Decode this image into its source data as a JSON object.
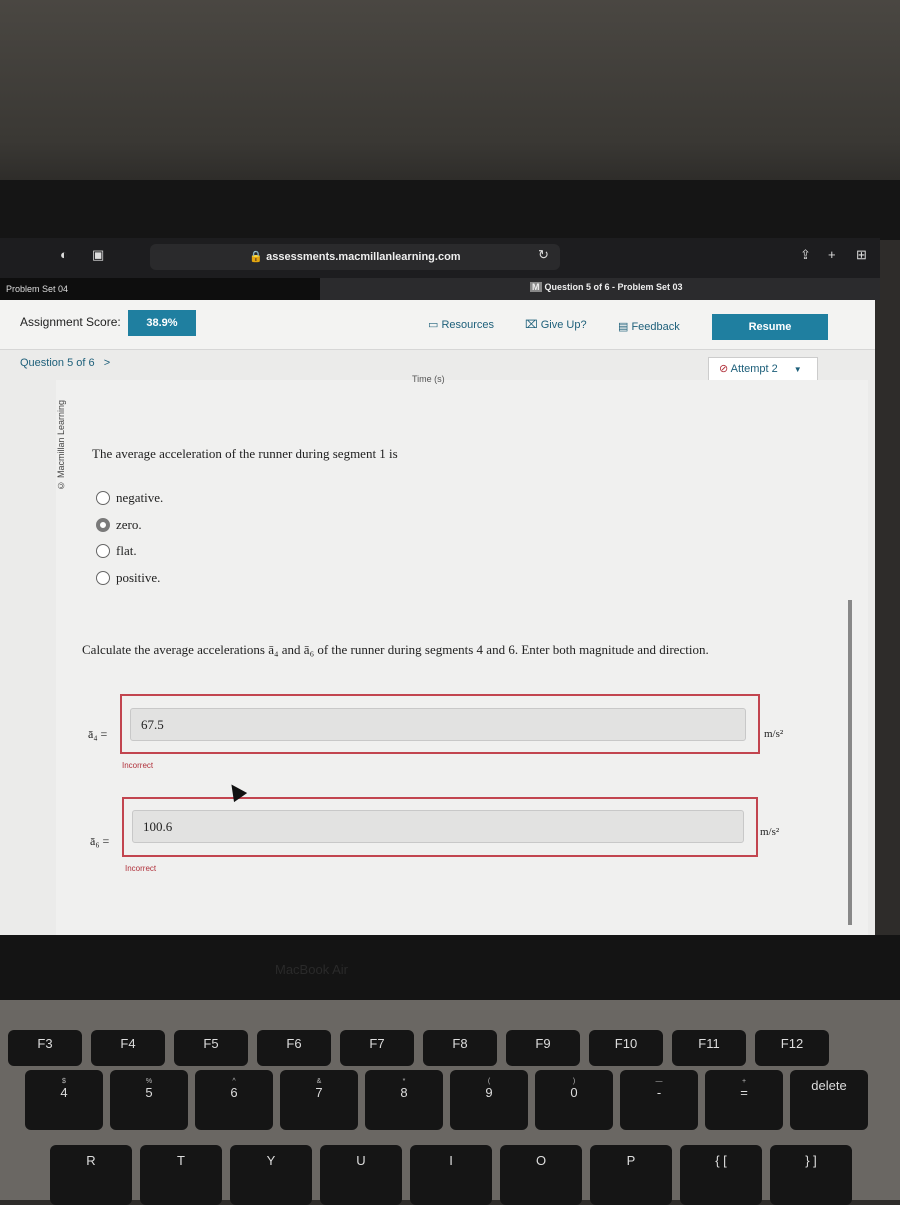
{
  "browser": {
    "url": "assessments.macmillanlearning.com",
    "tab1": "Problem Set 04",
    "tab2": "Question 5 of 6 - Problem Set 03",
    "tab2_badge": "M"
  },
  "header": {
    "score_label": "Assignment Score:",
    "score": "38.9%",
    "resources": "Resources",
    "give_up": "Give Up?",
    "feedback": "Feedback",
    "resume": "Resume"
  },
  "nav": {
    "question": "Question 5 of 6",
    "next": ">",
    "attempt": "Attempt 2"
  },
  "watermark": "© Macmillan Learning",
  "graph_axis_fragment": "Time (s)",
  "q1": {
    "prompt": "The average acceleration of the runner during segment 1 is",
    "options": [
      "negative.",
      "zero.",
      "flat.",
      "positive."
    ],
    "selected": 1
  },
  "q2": {
    "prompt": "Calculate the average accelerations ā₄ and ā₆ of the runner during segments 4 and 6. Enter both magnitude and direction.",
    "fields": [
      {
        "label": "ā₄ =",
        "value": "67.5",
        "unit": "m/s²",
        "status": "Incorrect"
      },
      {
        "label": "ā₆ =",
        "value": "100.6",
        "unit": "m/s²",
        "status": "Incorrect"
      }
    ]
  },
  "device": {
    "brand": "MacBook Air"
  },
  "keyboard": {
    "fn": [
      "F3",
      "F4",
      "F5",
      "F6",
      "F7",
      "F8",
      "F9",
      "F10",
      "F11",
      "F12"
    ],
    "num": [
      [
        "$",
        "4"
      ],
      [
        "%",
        "5"
      ],
      [
        "^",
        "6"
      ],
      [
        "&",
        "7"
      ],
      [
        "*",
        "8"
      ],
      [
        "(",
        "9"
      ],
      [
        ")",
        "0"
      ],
      [
        "—",
        "-"
      ],
      [
        "+",
        "="
      ],
      [
        "",
        "delete"
      ]
    ],
    "letters": [
      "R",
      "T",
      "Y",
      "U",
      "I",
      "O",
      "P",
      "{ [",
      "} ]"
    ]
  },
  "colors": {
    "accent": "#1f7fa0",
    "error": "#c2454f"
  }
}
